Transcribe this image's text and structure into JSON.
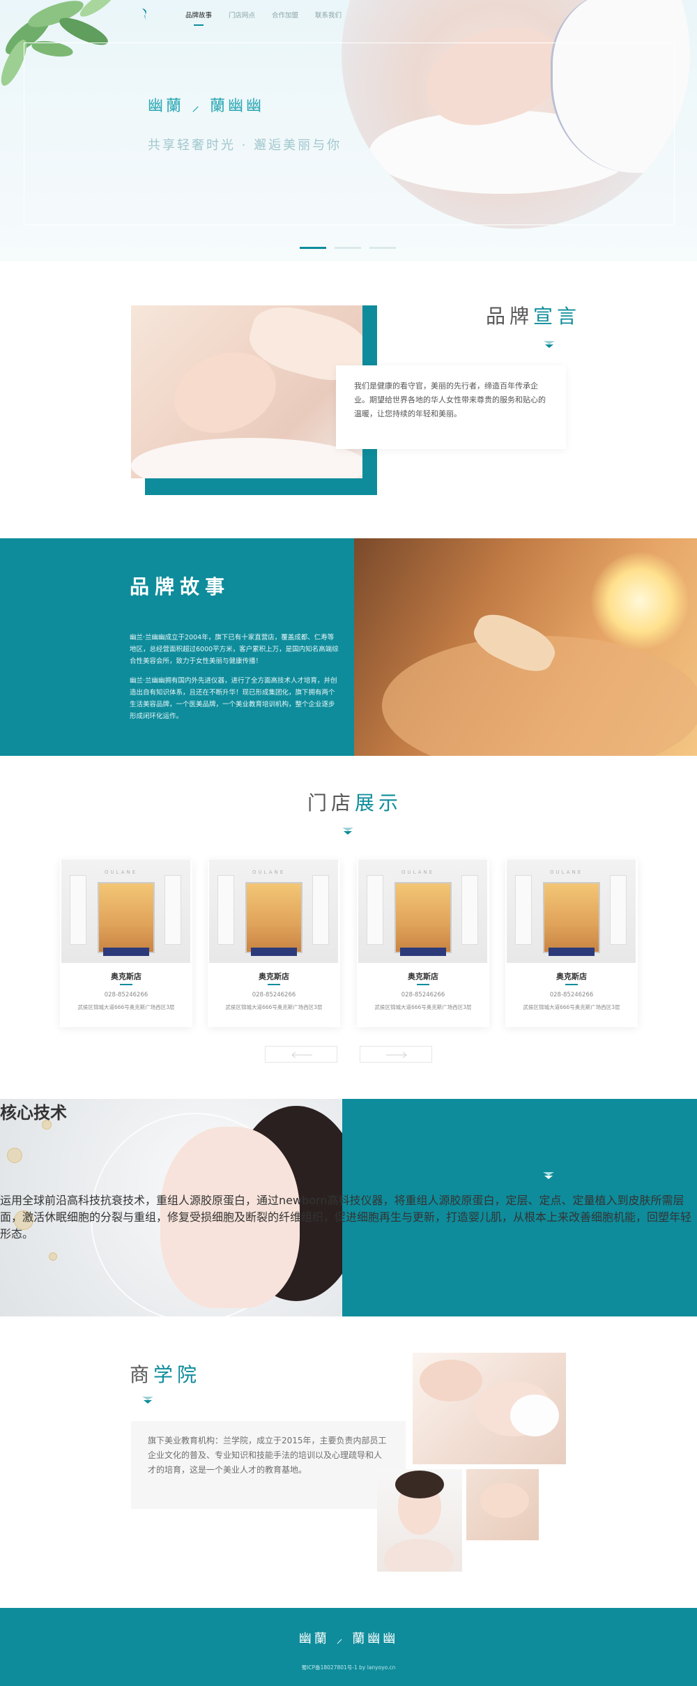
{
  "nav": {
    "items": [
      {
        "label": "品牌故事",
        "active": true
      },
      {
        "label": "门店网点",
        "active": false
      },
      {
        "label": "合作加盟",
        "active": false
      },
      {
        "label": "联系我们",
        "active": false
      }
    ]
  },
  "hero": {
    "brand": "幽蘭 ⸝ 蘭幽幽",
    "slogan": "共享轻奢时光 · 邂逅美丽与你",
    "carousel": {
      "slides": 3,
      "active_index": 0
    }
  },
  "manifesto": {
    "title_a": "品牌",
    "title_b": "宣言",
    "text": "我们是健康的看守官，美丽的先行者，缔造百年传承企业。期望给世界各地的华人女性带来尊贵的服务和贴心的温暖，让您持续的年轻和美丽。"
  },
  "story": {
    "title": "品牌故事",
    "p1": "幽兰·兰幽幽成立于2004年，旗下已有十家直营店，覆盖成都、仁寿等地区，总经营面积超过6000平方米，客户累积上万，是国内知名高端综合性美容会所，致力于女性美丽与健康传播！",
    "p2": "幽兰·兰幽幽拥有国内外先进仪器，进行了全方面高技术人才培育，并创造出自有知识体系，且还在不断升华！现已形成集团化，旗下拥有两个生活美容品牌，一个医美品牌，一个美业教育培训机构，整个企业逐步形成闭环化运作。"
  },
  "stores": {
    "title_a": "门店",
    "title_b": "展示",
    "sign": "OULANE",
    "items": [
      {
        "name": "奥克斯店",
        "tel": "028-85246266",
        "addr": "武侯区锦城大道666号奥克斯广场西区3层"
      },
      {
        "name": "奥克斯店",
        "tel": "028-85246266",
        "addr": "武侯区锦城大道666号奥克斯广场西区3层"
      },
      {
        "name": "奥克斯店",
        "tel": "028-85246266",
        "addr": "武侯区锦城大道666号奥克斯广场西区3层"
      },
      {
        "name": "奥克斯店",
        "tel": "028-85246266",
        "addr": "武侯区锦城大道666号奥克斯广场西区3层"
      }
    ]
  },
  "tech": {
    "title": "核心技术",
    "text": "运用全球前沿高科技抗衰技术，重组人源胶原蛋白，通过newborn高科技仪器，将重组人源胶原蛋白，定层、定点、定量植入到皮肤所需层面，激活休眠细胞的分裂与重组，修复受损细胞及断裂的纤维组织，促进细胞再生与更新，打造婴儿肌，从根本上来改善细胞机能，回塑年轻形态。"
  },
  "academy": {
    "title_a": "商",
    "title_b": "学院",
    "text": "旗下美业教育机构：兰学院，成立于2015年，主要负责内部员工企业文化的普及、专业知识和技能手法的培训以及心理疏导和人才的培育，这是一个美业人才的教育基地。"
  },
  "footer": {
    "brand": "幽蘭 ⸝ 蘭幽幽",
    "icp": "蜀ICP备18027801号-1 by lanyoyo.cn"
  },
  "colors": {
    "accent": "#0e8c9b",
    "accent_light": "#27a6b3"
  }
}
